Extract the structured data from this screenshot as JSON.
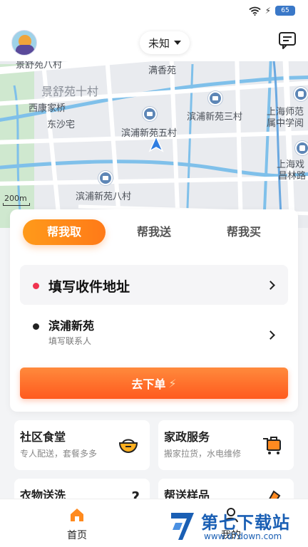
{
  "status_bar": {
    "battery_label": "65"
  },
  "top_bar": {
    "location": "未知"
  },
  "map": {
    "labels": {
      "top_left": "景舒苑八村",
      "jingshu": "景舒苑十村",
      "xikang": "西康家桥",
      "dongsha": "东沙宅",
      "manxiang": "满香苑",
      "binpu5": "滨浦新苑五村",
      "binpu3": "滨浦新苑三村",
      "binpu8": "滨浦新苑八村",
      "school1": "上海师范",
      "school2": "属中学阅",
      "xiju1": "上海戏",
      "xiju2": "昌林路"
    },
    "scale": "200m"
  },
  "order_card": {
    "tabs": [
      "帮我取",
      "帮我送",
      "帮我买"
    ],
    "pickup_placeholder": "填写收件地址",
    "sender_name": "滨浦新苑",
    "sender_hint": "填写联系人",
    "submit_label": "去下单"
  },
  "services": [
    {
      "title": "社区食堂",
      "desc": "专人配送，套餐多多",
      "icon": "food-bowl-icon"
    },
    {
      "title": "家政服务",
      "desc": "搬家拉货，水电维修",
      "icon": "cleaning-cart-icon"
    },
    {
      "title": "衣物送洗",
      "desc": "",
      "icon": "hanger-icon"
    },
    {
      "title": "帮送样品",
      "desc": "",
      "icon": "sample-icon"
    }
  ],
  "bottom_nav": {
    "home": "首页",
    "mine": "我的"
  },
  "watermark": {
    "name": "第七下载站",
    "url": "www.d7down.com"
  },
  "colors": {
    "accent": "#ff7a18",
    "pickup_dot": "#f0334f",
    "map_bg": "#e9ebef",
    "watermark": "#1a5fb4"
  }
}
